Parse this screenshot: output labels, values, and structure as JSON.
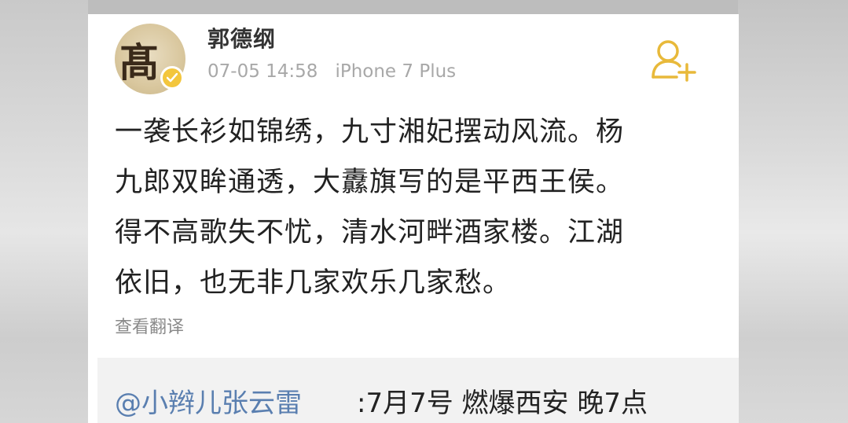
{
  "post": {
    "username": "郭德纲",
    "timestamp": "07-05 14:58",
    "device": "iPhone 7 Plus",
    "lines": [
      "一袭长衫如锦绣，九寸湘妃摆动风流。杨",
      "九郎双眸通透，大纛旗写的是平西王侯。",
      "得不高歌失不忧，清水河畔酒家楼。江湖",
      "依旧，也无非几家欢乐几家愁。"
    ],
    "translate_label": "查看翻译",
    "follow_icon": "add-user-icon",
    "verified_icon": "verified-badge-icon"
  },
  "repost": {
    "mention": "@小辫儿张云雷",
    "text": ":7月7号 燃爆西安 晚7点"
  },
  "colors": {
    "accent_gold": "#e8b93a",
    "mention_blue": "#5a7fb0",
    "meta_gray": "#a8a8a8"
  }
}
